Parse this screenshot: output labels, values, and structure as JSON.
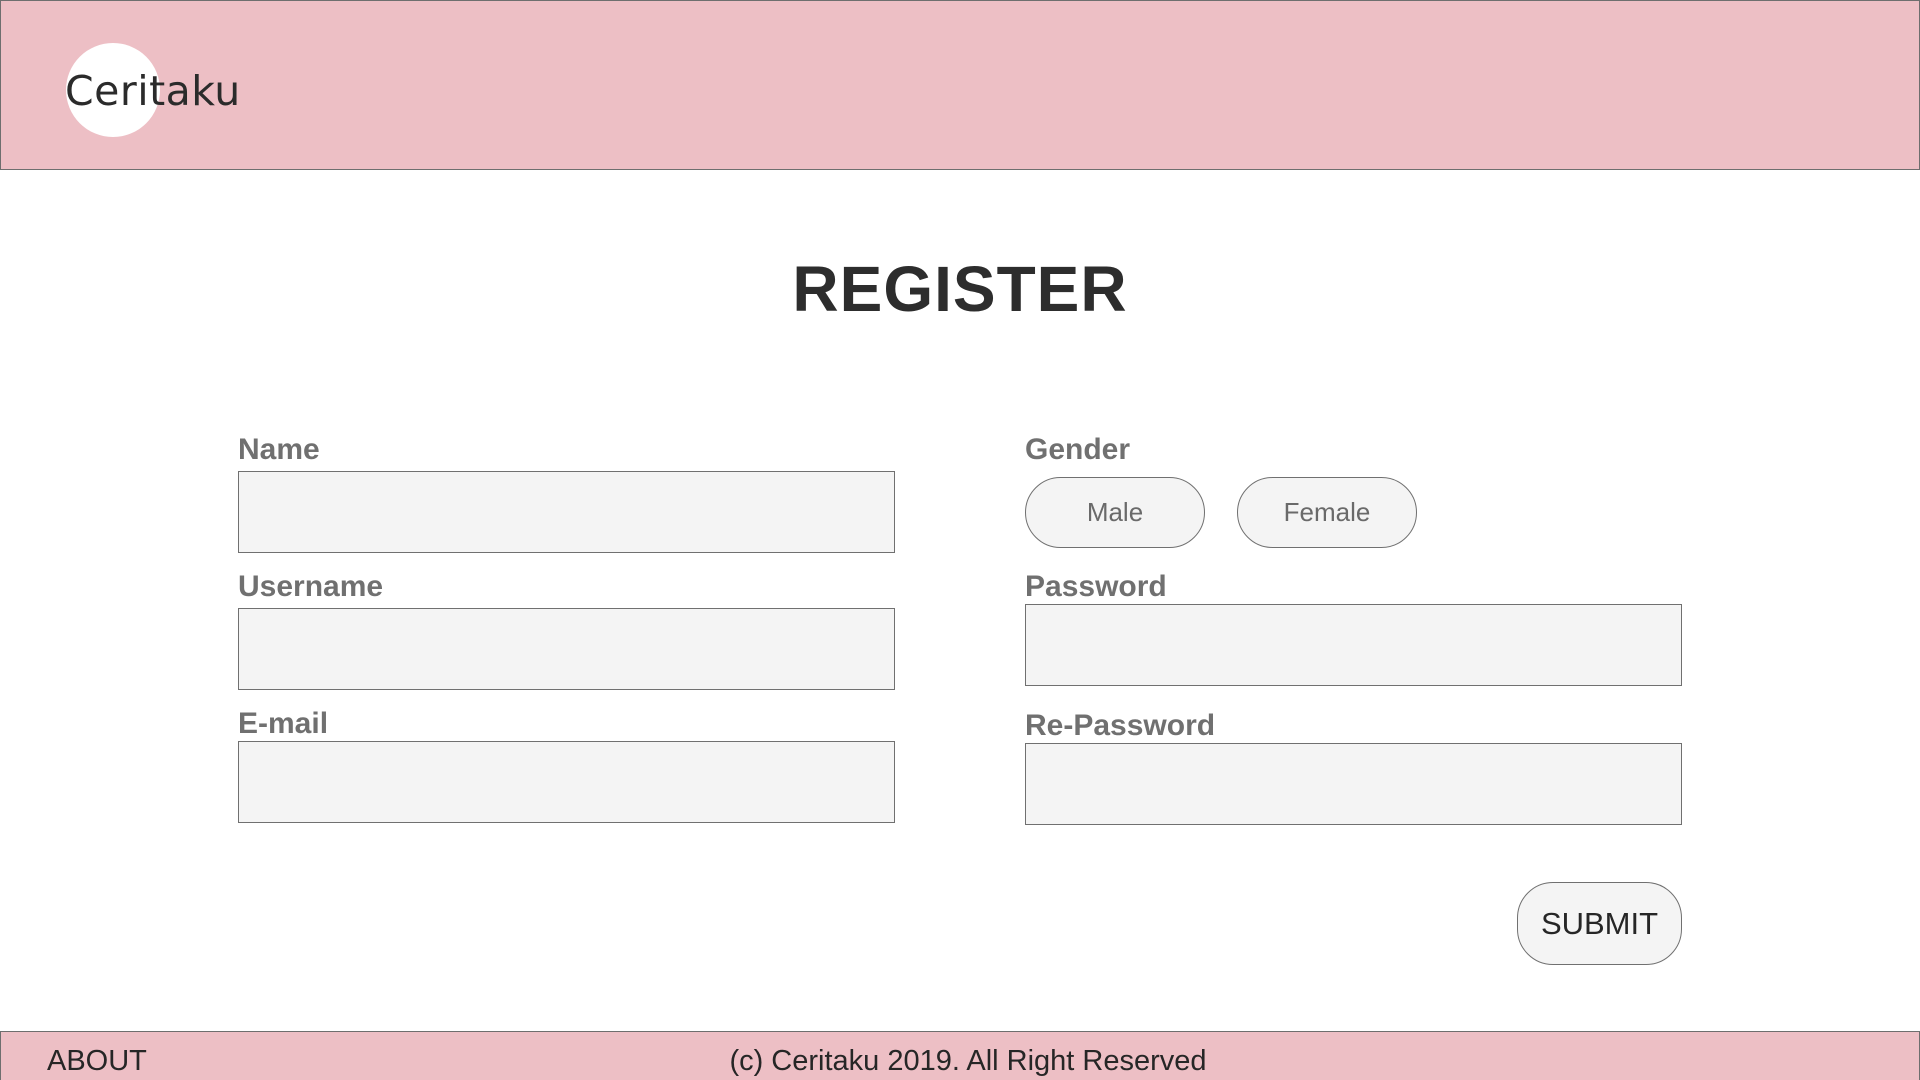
{
  "header": {
    "logo_text": "Ceritaku"
  },
  "page": {
    "title": "REGISTER"
  },
  "form": {
    "name": {
      "label": "Name",
      "value": ""
    },
    "username": {
      "label": "Username",
      "value": ""
    },
    "email": {
      "label": "E-mail",
      "value": ""
    },
    "gender": {
      "label": "Gender",
      "options": [
        "Male",
        "Female"
      ]
    },
    "password": {
      "label": "Password",
      "value": ""
    },
    "repassword": {
      "label": "Re-Password",
      "value": ""
    },
    "submit_label": "SUBMIT"
  },
  "footer": {
    "about_label": "ABOUT",
    "copyright": "(c) Ceritaku 2019. All Right Reserved"
  },
  "colors": {
    "header_bg": "#edbfc5",
    "input_bg": "#f4f4f4",
    "border": "#707070"
  }
}
